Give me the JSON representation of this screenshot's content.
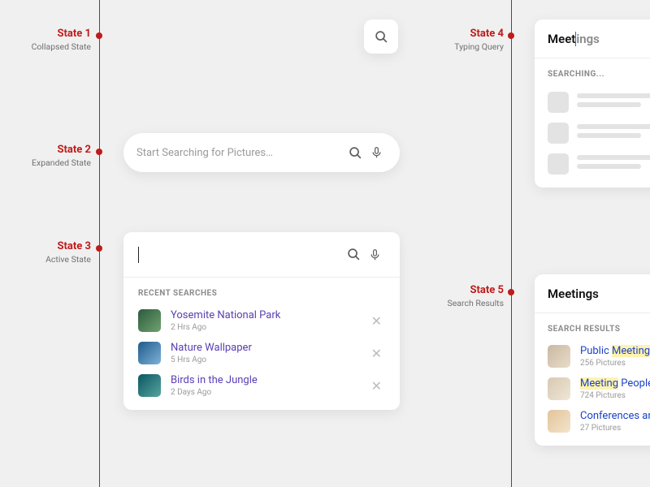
{
  "states": {
    "s1": {
      "title": "State 1",
      "sub": "Collapsed State"
    },
    "s2": {
      "title": "State 2",
      "sub": "Expanded State"
    },
    "s3": {
      "title": "State 3",
      "sub": "Active State"
    },
    "s4": {
      "title": "State 4",
      "sub": "Typing Query"
    },
    "s5": {
      "title": "State 5",
      "sub": "Search Results"
    }
  },
  "expanded": {
    "placeholder": "Start Searching for Pictures…"
  },
  "active": {
    "section": "RECENT SEARCHES",
    "items": [
      {
        "name": "Yosemite National Park",
        "time": "2 Hrs Ago"
      },
      {
        "name": "Nature Wallpaper",
        "time": "5 Hrs Ago"
      },
      {
        "name": "Birds in the Jungle",
        "time": "2 Days Ago"
      }
    ]
  },
  "typing": {
    "query_prefix": "Meet",
    "query_suffix": "ings",
    "section": "SEARCHING..."
  },
  "results": {
    "query": "Meetings",
    "section": "SEARCH RESULTS",
    "items": [
      {
        "pre": "Public ",
        "hl": "Meetings",
        "post": "",
        "meta": "256 Pictures"
      },
      {
        "pre": "",
        "hl": "Meeting",
        "post": " People",
        "meta": "724 Pictures"
      },
      {
        "pre": "Conferences and",
        "hl": "",
        "post": "",
        "meta": "27 Pictures"
      }
    ]
  }
}
